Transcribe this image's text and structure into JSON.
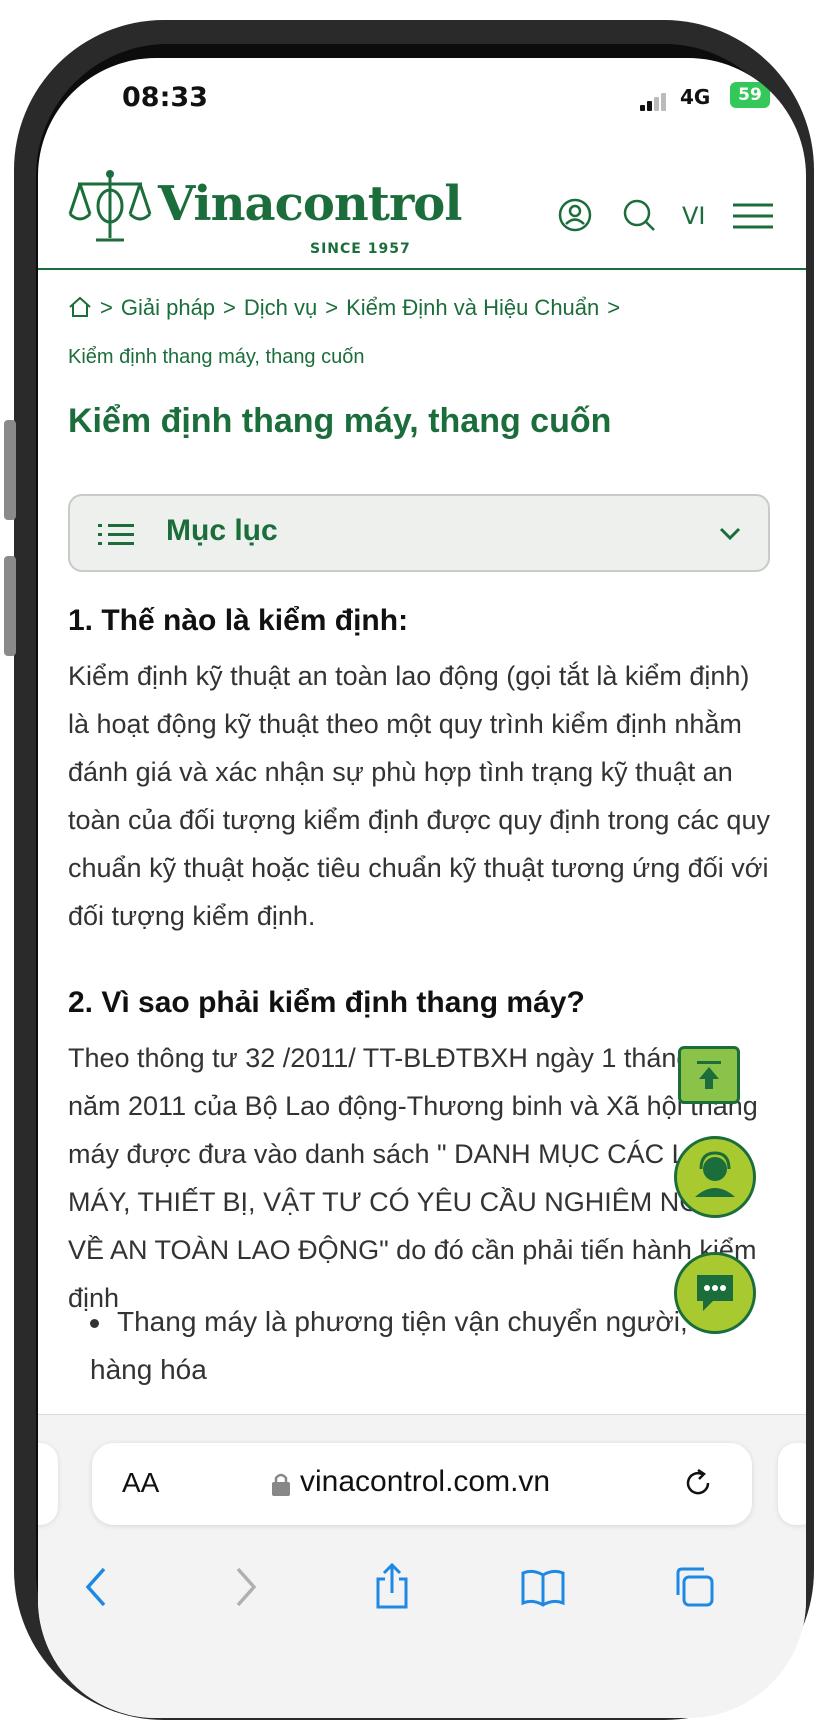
{
  "status_bar": {
    "time": "08:33",
    "network": "4G",
    "battery": "59"
  },
  "header": {
    "logo_name": "Vinacontrol",
    "logo_since": "SINCE 1957",
    "language": "VI"
  },
  "breadcrumb": {
    "items": [
      "Giải pháp",
      "Dịch vụ",
      "Kiểm Định và Hiệu Chuẩn",
      "Kiểm định thang máy, thang cuốn"
    ],
    "separator": ">"
  },
  "page_title": "Kiểm định thang máy, thang cuốn",
  "toc": {
    "label": "Mục lục"
  },
  "sections": [
    {
      "heading": "1. Thế nào là kiểm định:",
      "body": "Kiểm định kỹ thuật an toàn lao động (gọi tắt là kiểm định) là hoạt động kỹ thuật theo một quy trình kiểm định nhằm đánh giá và xác nhận sự phù hợp tình trạng kỹ thuật an toàn của đối tượng kiểm định được quy định trong các quy chuẩn kỹ thuật hoặc tiêu chuẩn kỹ thuật tương ứng đối với đối tượng kiểm định."
    },
    {
      "heading": "2. Vì sao phải kiểm định thang máy?",
      "body": "Theo thông tư 32 /2011/ TT-BLĐTBXH ngày 1 tháng 11 năm 2011 của Bộ Lao động-Thương binh và Xã hội thang máy được đưa vào danh sách \" DANH MỤC CÁC LOẠI MÁY, THIẾT BỊ, VẬT TƯ CÓ YÊU CẦU NGHIÊM NGẶT VỀ AN TOÀN LAO ĐỘNG\" do đó cần phải tiến hành kiểm định"
    }
  ],
  "bullets": [
    "Thang máy là phương tiện vận chuyển người, hàng hóa"
  ],
  "browser": {
    "text_size_label": "AA",
    "url": "vinacontrol.com.vn"
  },
  "colors": {
    "brand_green": "#1b6e3b",
    "fab_green": "#a8c92f"
  }
}
